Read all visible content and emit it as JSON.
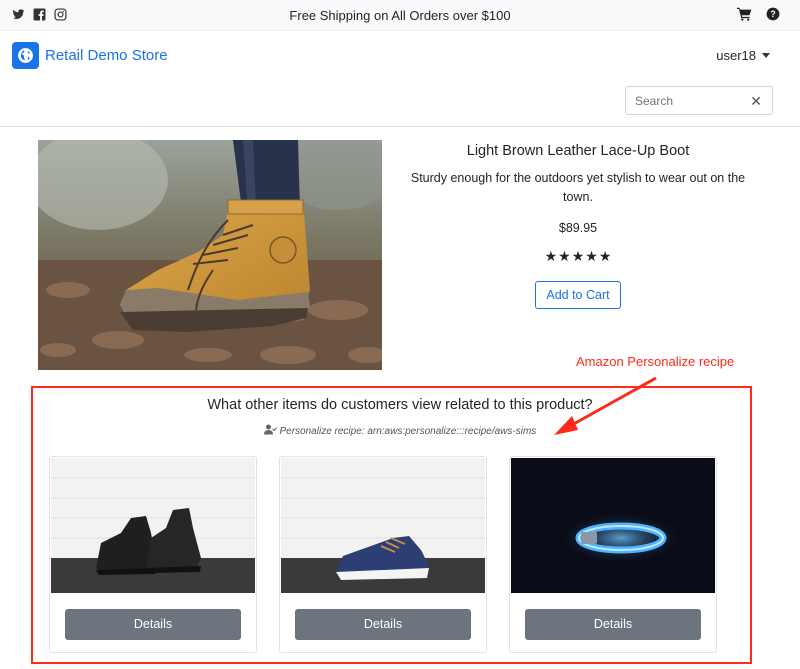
{
  "topbar": {
    "social_icons": [
      "twitter-icon",
      "facebook-icon",
      "instagram-icon"
    ],
    "promo_text": "Free Shipping on All Orders over $100",
    "right_icons": [
      "shopping-cart-icon",
      "help-icon"
    ]
  },
  "header": {
    "brand_name": "Retail Demo Store",
    "brand_icon": "globe-icon",
    "user_name": "user18",
    "search_placeholder": "Search",
    "search_clear": "✕"
  },
  "product": {
    "name": "Light Brown Leather Lace-Up Boot",
    "description": "Sturdy enough for the outdoors yet stylish to wear out on the town.",
    "price": "$89.95",
    "rating_stars": 5,
    "add_to_cart_label": "Add to Cart"
  },
  "annotation": {
    "label": "Amazon Personalize recipe",
    "color": "#ff2a1a"
  },
  "recommendations": {
    "title": "What other items do customers view related to this product?",
    "recipe_text": "Personalize recipe: arn:aws:personalize:::recipe/aws-sims",
    "cards": [
      {
        "details_label": "Details"
      },
      {
        "details_label": "Details"
      },
      {
        "details_label": "Details"
      }
    ]
  },
  "colors": {
    "accent": "#1a73e8",
    "button_gray": "#6c757d"
  }
}
